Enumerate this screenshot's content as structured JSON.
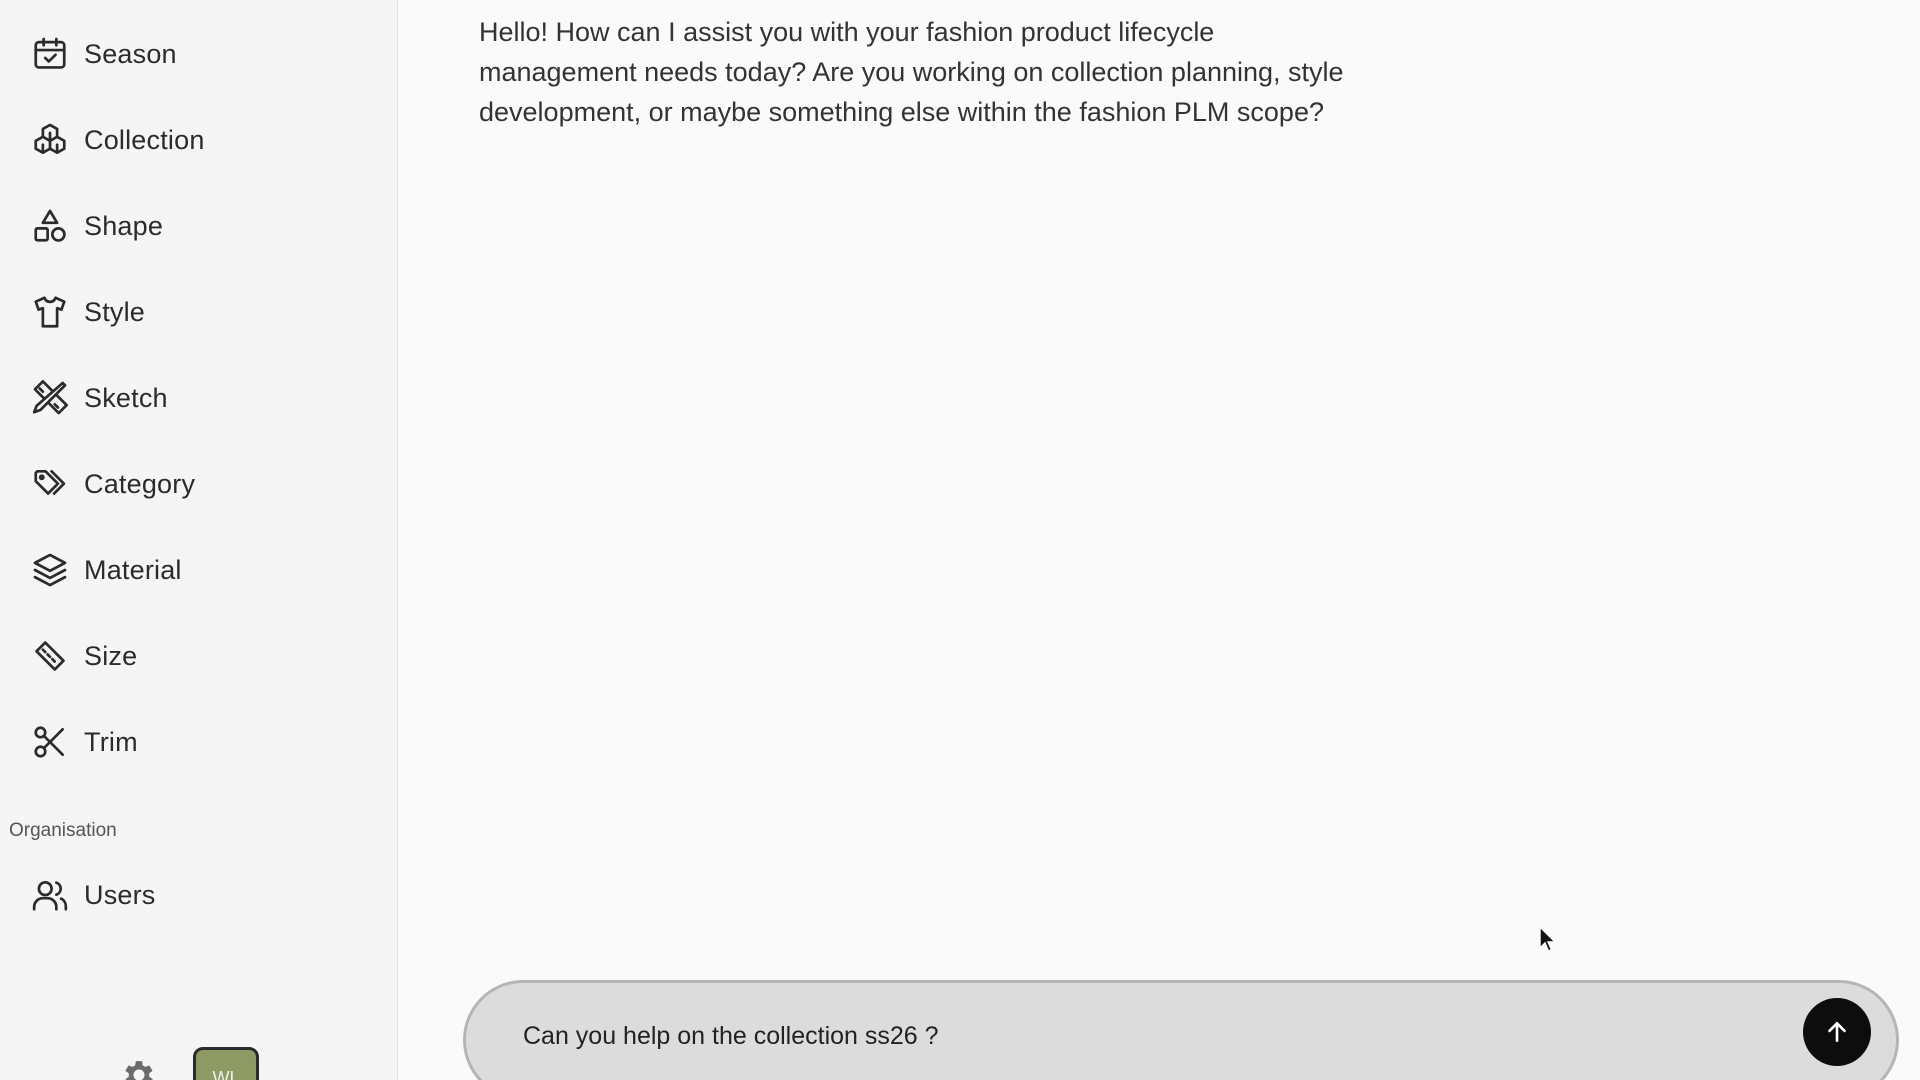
{
  "sidebar": {
    "items": [
      {
        "label": "Season",
        "icon": "calendar-check-icon"
      },
      {
        "label": "Collection",
        "icon": "boxes-icon"
      },
      {
        "label": "Shape",
        "icon": "shapes-icon"
      },
      {
        "label": "Style",
        "icon": "shirt-icon"
      },
      {
        "label": "Sketch",
        "icon": "pencil-ruler-icon"
      },
      {
        "label": "Category",
        "icon": "tags-icon"
      },
      {
        "label": "Material",
        "icon": "layers-icon"
      },
      {
        "label": "Size",
        "icon": "ruler-icon"
      },
      {
        "label": "Trim",
        "icon": "scissors-icon"
      }
    ],
    "organisation_label": "Organisation",
    "organisation_items": [
      {
        "label": "Users",
        "icon": "users-icon"
      }
    ],
    "avatar_initials": "WL",
    "settings_icon": "gear-icon"
  },
  "chat": {
    "assistant_message": "Hello! How can I assist you with your fashion product lifecycle management needs today? Are you working on collection planning, style development, or maybe something else within the fashion PLM scope?",
    "input_value": "Can you help on the collection ss26 ?",
    "send_icon": "arrow-up-icon"
  }
}
